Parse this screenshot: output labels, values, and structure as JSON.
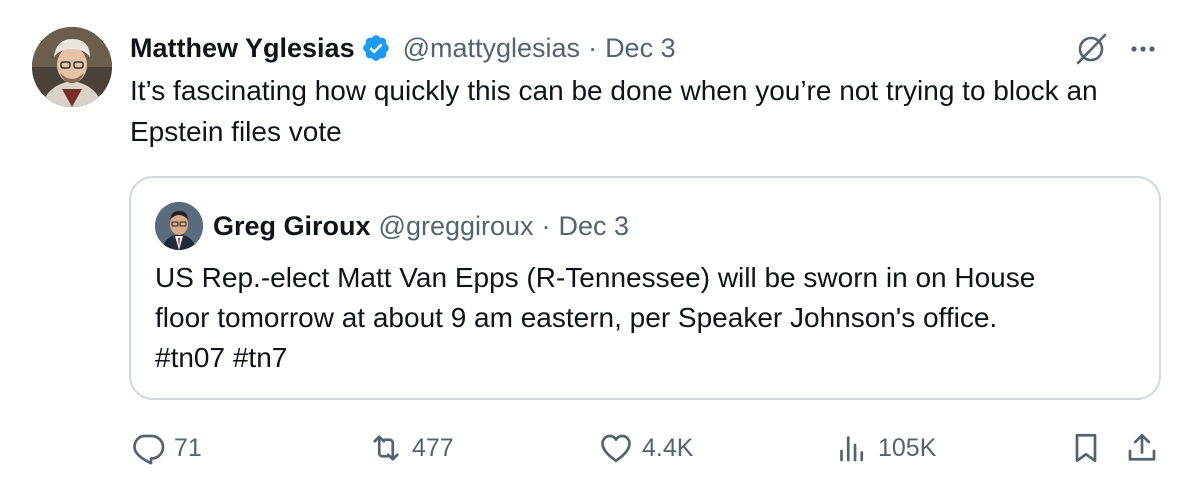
{
  "tweet": {
    "author_name": "Matthew Yglesias",
    "handle": "@mattyglesias",
    "separator": "·",
    "date": "Dec 3",
    "text": "It’s fascinating how quickly this can be done when you’re not trying to block an Epstein files vote",
    "verified_icon": "verified-badge-icon",
    "grok_icon": "grok-icon",
    "more_icon": "more-icon"
  },
  "quote": {
    "author_name": "Greg Giroux",
    "handle": "@greggiroux",
    "separator": "·",
    "date": "Dec 3",
    "text_lines": [
      "US Rep.-elect Matt Van Epps (R-Tennessee) will be sworn in on House",
      "floor tomorrow at about 9 am eastern, per Speaker Johnson's office.",
      "#tn07 #tn7"
    ]
  },
  "actions": {
    "replies": "71",
    "retweets": "477",
    "likes": "4.4K",
    "views": "105K"
  },
  "colors": {
    "text_primary": "#0f1419",
    "text_secondary": "#536471",
    "verified_blue": "#1d9bf0",
    "border": "#cfd9de"
  }
}
